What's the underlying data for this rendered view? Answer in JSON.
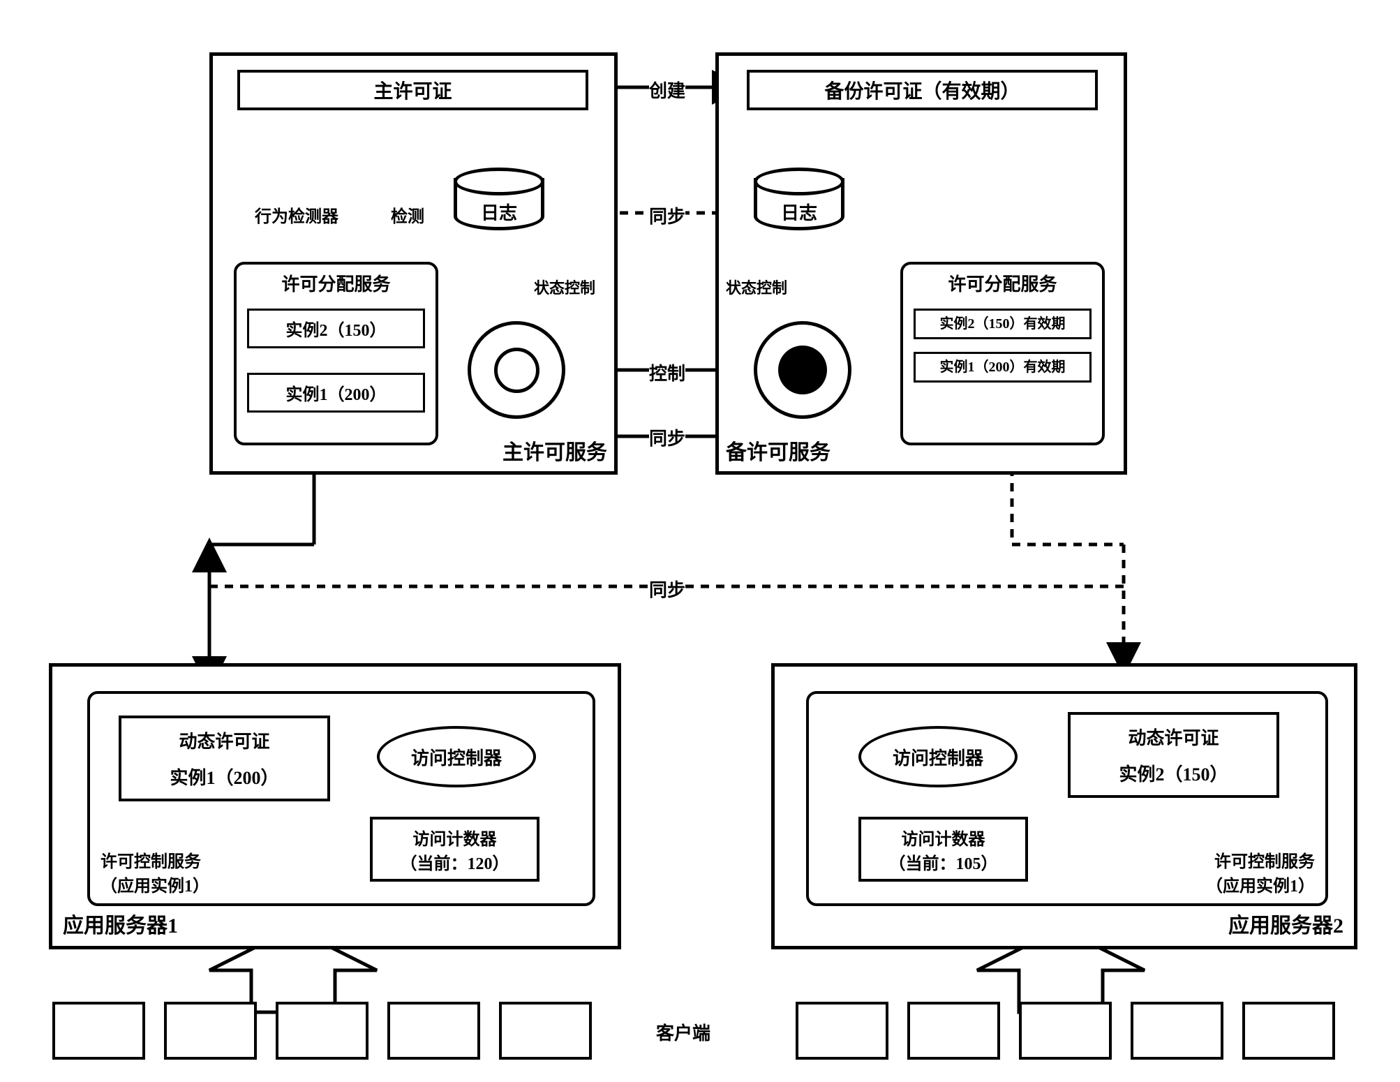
{
  "top": {
    "main_service": {
      "title": "主许可服务",
      "license": "主许可证",
      "detector": "行为检测器",
      "detect_label": "检测",
      "log": "日志",
      "alloc_service": "许可分配服务",
      "instance2": "实例2（150）",
      "instance1": "实例1（200）",
      "state_control": "状态控制"
    },
    "backup_service": {
      "title": "备许可服务",
      "license": "备份许可证（有效期）",
      "log": "日志",
      "alloc_service": "许可分配服务",
      "instance2": "实例2（150）有效期",
      "instance1": "实例1（200）有效期",
      "state_control": "状态控制"
    },
    "edges": {
      "create": "创建",
      "sync_log": "同步",
      "control": "控制",
      "sync_alloc": "同步"
    }
  },
  "middle": {
    "sync": "同步"
  },
  "bottom": {
    "server1": {
      "title": "应用服务器1",
      "ctrl_service": "许可控制服务（应用实例1）",
      "dynamic_license_title": "动态许可证",
      "dynamic_license_inst": "实例1（200）",
      "access_controller": "访问控制器",
      "counter_title": "访问计数器",
      "counter_val": "（当前：120）"
    },
    "server2": {
      "title": "应用服务器2",
      "ctrl_service": "许可控制服务（应用实例1）",
      "dynamic_license_title": "动态许可证",
      "dynamic_license_inst": "实例2（150）",
      "access_controller": "访问控制器",
      "counter_title": "访问计数器",
      "counter_val": "（当前：105）"
    },
    "client_label": "客户端"
  }
}
